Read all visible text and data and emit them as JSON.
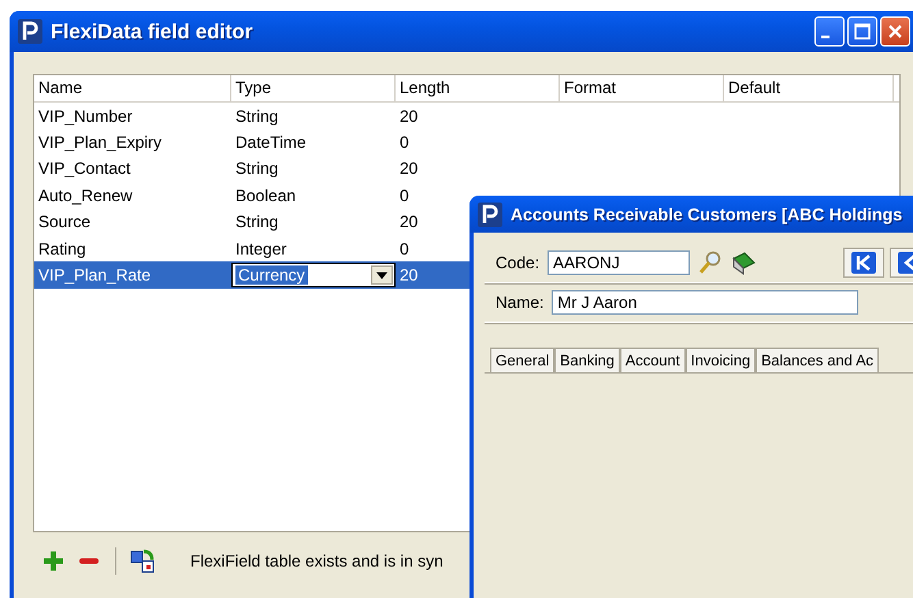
{
  "editor_window": {
    "title": "FlexiData field editor",
    "columns": [
      "Name",
      "Type",
      "Length",
      "Format",
      "Default"
    ],
    "rows": [
      {
        "name": "VIP_Number",
        "type": "String",
        "length": "20",
        "selected": false
      },
      {
        "name": "VIP_Plan_Expiry",
        "type": "DateTime",
        "length": "0",
        "selected": false
      },
      {
        "name": "VIP_Contact",
        "type": "String",
        "length": "20",
        "selected": false
      },
      {
        "name": "Auto_Renew",
        "type": "Boolean",
        "length": "0",
        "selected": false
      },
      {
        "name": "Source",
        "type": "String",
        "length": "20",
        "selected": false
      },
      {
        "name": "Rating",
        "type": "Integer",
        "length": "0",
        "selected": false
      },
      {
        "name": "VIP_Plan_Rate",
        "type": "Currency",
        "length": "20",
        "selected": true
      }
    ],
    "status": "FlexiField table exists and is in syn"
  },
  "customer_window": {
    "title": "Accounts Receivable Customers [ABC Holdings",
    "code_label": "Code:",
    "code": "AARONJ",
    "name_label": "Name:",
    "name": "Mr J Aaron",
    "tabs": [
      "General",
      "Banking",
      "Account",
      "Invoicing",
      "Balances and Ac"
    ]
  }
}
